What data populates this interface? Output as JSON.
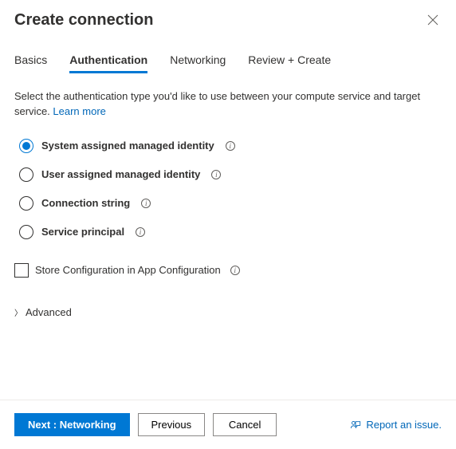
{
  "header": {
    "title": "Create connection"
  },
  "tabs": {
    "items": [
      {
        "label": "Basics"
      },
      {
        "label": "Authentication"
      },
      {
        "label": "Networking"
      },
      {
        "label": "Review + Create"
      }
    ],
    "activeIndex": 1
  },
  "description": {
    "text": "Select the authentication type you'd like to use between your compute service and target service. ",
    "linkText": "Learn more"
  },
  "authOptions": {
    "items": [
      {
        "label": "System assigned managed identity",
        "checked": true
      },
      {
        "label": "User assigned managed identity",
        "checked": false
      },
      {
        "label": "Connection string",
        "checked": false
      },
      {
        "label": "Service principal",
        "checked": false
      }
    ]
  },
  "storeConfig": {
    "label": "Store Configuration in App Configuration",
    "checked": false
  },
  "advanced": {
    "label": "Advanced"
  },
  "footer": {
    "primary": "Next : Networking",
    "previous": "Previous",
    "cancel": "Cancel",
    "report": "Report an issue."
  }
}
